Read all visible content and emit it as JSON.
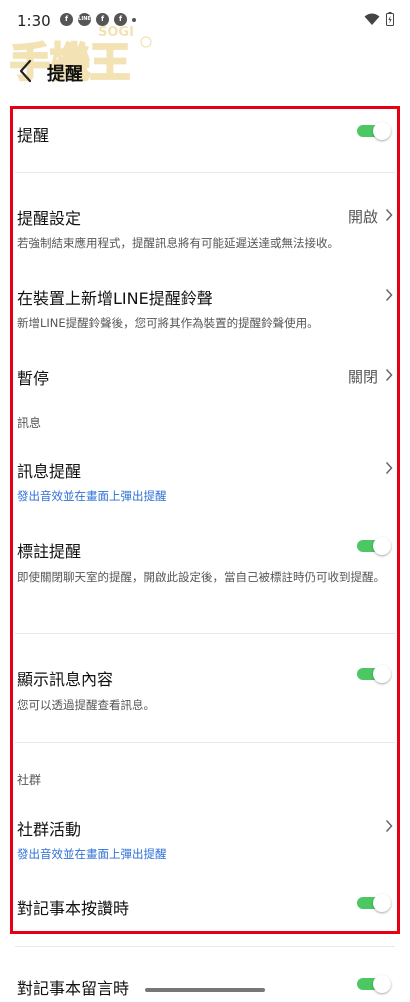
{
  "status_bar": {
    "time": "1:30",
    "notifications": [
      {
        "icon": "facebook-icon",
        "glyph": "f"
      },
      {
        "icon": "line-icon",
        "glyph": "LINE"
      },
      {
        "icon": "facebook-icon",
        "glyph": "f"
      },
      {
        "icon": "facebook-icon",
        "glyph": "f"
      }
    ]
  },
  "watermark": {
    "text": "SOGI",
    "subtext": "手機王"
  },
  "header": {
    "back_icon": "chevron-left-icon",
    "title": "提醒"
  },
  "settings": {
    "notify": {
      "title": "提醒",
      "toggle_on": true
    },
    "notify_settings": {
      "title": "提醒設定",
      "value": "開啟",
      "desc": "若強制結束應用程式，提醒訊息將有可能延遲送達或無法接收。"
    },
    "ringtone": {
      "title": "在裝置上新增LINE提醒鈴聲",
      "desc": "新增LINE提醒鈴聲後，您可將其作為裝置的提醒鈴聲使用。"
    },
    "pause": {
      "title": "暫停",
      "value": "關閉"
    },
    "section_messages": "訊息",
    "message_notify": {
      "title": "訊息提醒",
      "desc": "發出音效並在畫面上彈出提醒"
    },
    "mention_notify": {
      "title": "標註提醒",
      "toggle_on": true,
      "desc": "即使關閉聊天室的提醒，開啟此設定後，當自己被標註時仍可收到提醒。"
    },
    "show_content": {
      "title": "顯示訊息內容",
      "toggle_on": true,
      "desc": "您可以透過提醒查看訊息。"
    },
    "section_community": "社群",
    "community_activity": {
      "title": "社群活動",
      "desc": "發出音效並在畫面上彈出提醒"
    },
    "note_like": {
      "title": "對記事本按讚時",
      "toggle_on": true
    },
    "note_comment": {
      "title": "對記事本留言時",
      "toggle_on": true
    }
  },
  "colors": {
    "toggle_on": "#4cc764",
    "highlight_frame": "#e60012",
    "link_blue": "#2d6fd6"
  }
}
